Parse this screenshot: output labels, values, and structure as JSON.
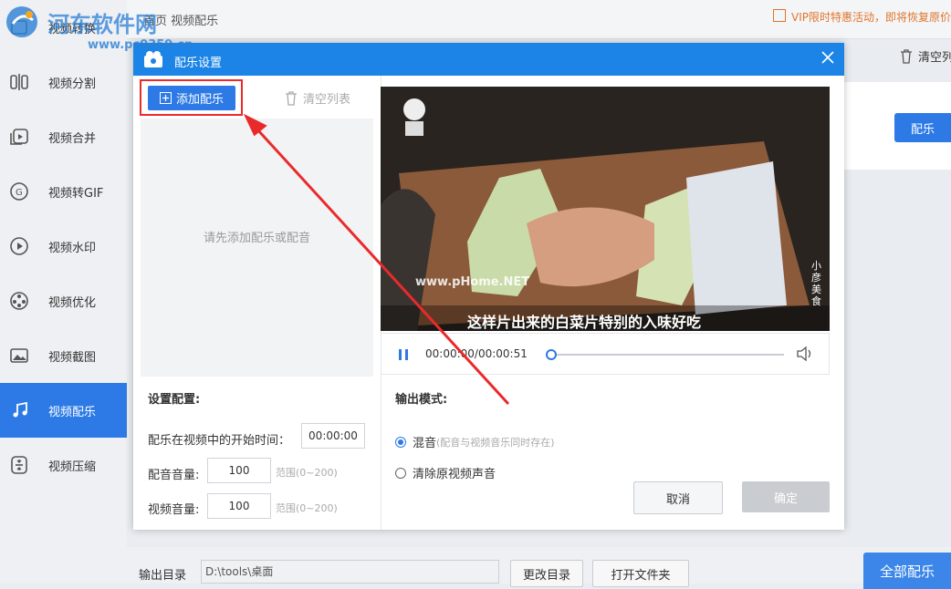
{
  "watermark": {
    "title": "河东软件网",
    "url": "www.pc0359.cn"
  },
  "topbar": {
    "breadcrumb": "首页  视频配乐",
    "vip_text": "VIP限时特惠活动，即将恢复原价"
  },
  "sidebar": {
    "items": [
      {
        "label": "视频转换",
        "icon": "convert-icon"
      },
      {
        "label": "视频分割",
        "icon": "split-icon"
      },
      {
        "label": "视频合并",
        "icon": "merge-icon"
      },
      {
        "label": "视频转GIF",
        "icon": "gif-icon"
      },
      {
        "label": "视频水印",
        "icon": "watermark-icon"
      },
      {
        "label": "视频优化",
        "icon": "optimize-icon"
      },
      {
        "label": "视频截图",
        "icon": "screenshot-icon"
      },
      {
        "label": "视频配乐",
        "icon": "music-icon",
        "active": true
      },
      {
        "label": "视频压缩",
        "icon": "compress-icon"
      }
    ]
  },
  "background": {
    "clear_all": "清空列表",
    "dub_button": "配乐"
  },
  "bottom": {
    "output_label": "输出目录",
    "output_path": "D:\\tools\\桌面",
    "change_dir": "更改目录",
    "open_folder": "打开文件夹",
    "all_dub": "全部配乐"
  },
  "dialog": {
    "title": "配乐设置",
    "add_music": "添加配乐",
    "clear_list": "清空列表",
    "empty_hint": "请先添加配乐或配音",
    "config_title": "设置配置:",
    "start_time_label": "配乐在视频中的开始时间：",
    "start_time": "00:00:00",
    "dub_volume_label": "配音音量:",
    "dub_volume": "100",
    "video_volume_label": "视频音量:",
    "video_volume": "100",
    "range_hint": "范围(0~200)",
    "video": {
      "subtitle": "这样片出来的白菜片特别的入味好吃",
      "site_watermark": "www.pHome.NET",
      "side_text": "小彦美食"
    },
    "player": {
      "time": "00:00:00/00:00:51",
      "progress": 0
    },
    "output_mode_title": "输出模式:",
    "modes": [
      {
        "label": "混音",
        "hint": "(配音与视频音乐同时存在)",
        "selected": true
      },
      {
        "label": "清除原视频声音",
        "hint": "",
        "selected": false
      }
    ],
    "cancel": "取消",
    "confirm": "确定"
  },
  "colors": {
    "accent": "#2d7ae6",
    "header": "#1b84e6",
    "highlight": "#ea2a2a"
  }
}
